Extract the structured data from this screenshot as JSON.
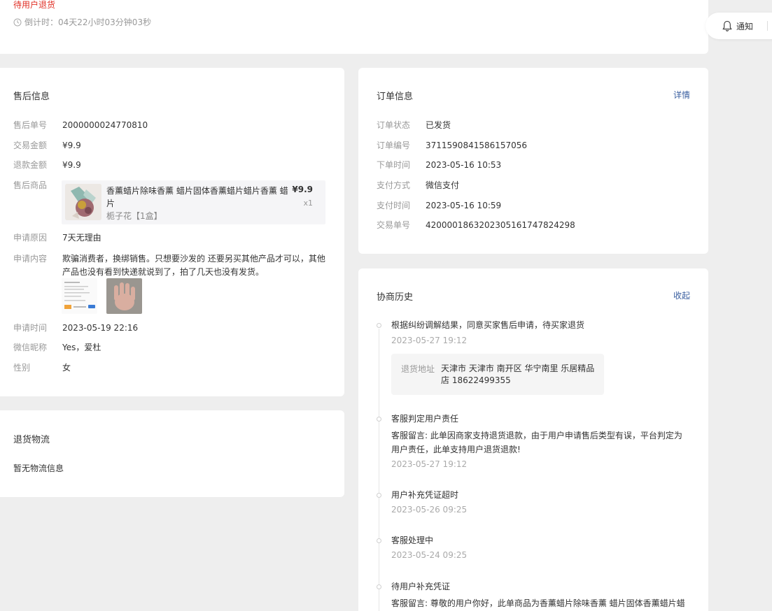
{
  "status": {
    "title": "待用户退货",
    "countdown": "倒计时：04天22小时03分钟03秒"
  },
  "notify": {
    "label": "通知"
  },
  "aftersale": {
    "title": "售后信息",
    "rows": [
      {
        "label": "售后单号",
        "value": "2000000024770810"
      },
      {
        "label": "交易金额",
        "value": "¥9.9"
      },
      {
        "label": "退款金额",
        "value": "¥9.9"
      },
      {
        "label": "售后商品",
        "value": ""
      },
      {
        "label": "申请原因",
        "value": "7天无理由"
      },
      {
        "label": "申请内容",
        "value": "欺骗消费者，换绑销售。只想要沙发的 还要另买其他产品才可以，其他产品也没有看到快递就说到了，拍了几天也没有发货。"
      },
      {
        "label": "申请时间",
        "value": "2023-05-19 22:16"
      },
      {
        "label": "微信昵称",
        "value": "Yes，爱杜"
      },
      {
        "label": "性别",
        "value": "女"
      }
    ],
    "product": {
      "name": "香薰蜡片除味香薰 蜡片固体香薰蜡片蜡片香薰 蜡片",
      "sku": "栀子花【1盒】",
      "price": "¥9.9",
      "qty": "x1"
    }
  },
  "logistics": {
    "title": "退货物流",
    "empty": "暂无物流信息"
  },
  "order": {
    "title": "订单信息",
    "detail_link": "详情",
    "rows": [
      {
        "label": "订单状态",
        "value": "已发货"
      },
      {
        "label": "订单编号",
        "value": "3711590841586157056"
      },
      {
        "label": "下单时间",
        "value": "2023-05-16 10:53"
      },
      {
        "label": "支付方式",
        "value": "微信支付"
      },
      {
        "label": "支付时间",
        "value": "2023-05-16 10:59"
      },
      {
        "label": "交易单号",
        "value": "4200001863202305161747824298"
      }
    ]
  },
  "history": {
    "title": "协商历史",
    "collapse_link": "收起",
    "items": [
      {
        "title": "根据纠纷调解结果，同意买家售后申请，待买家退货",
        "time": "2023-05-27 19:12",
        "address_label": "退货地址",
        "address": "天津市 天津市 南开区 华宁南里 乐居精品店 18622499355"
      },
      {
        "title": "客服判定用户责任",
        "text": "客服留言: 此单因商家支持退货退款，由于用户申请售后类型有误，平台判定为用户责任，此单支持用户退货退款!",
        "time": "2023-05-27 19:12"
      },
      {
        "title": "用户补充凭证超时",
        "time": "2023-05-26 09:25"
      },
      {
        "title": "客服处理中",
        "time": "2023-05-24 09:25"
      },
      {
        "title": "待用户补充凭证",
        "text": "客服留言: 尊敬的用户你好，此单商品为香薰蜡片除味香薰 蜡片固体香薰蜡片蜡片"
      }
    ]
  }
}
